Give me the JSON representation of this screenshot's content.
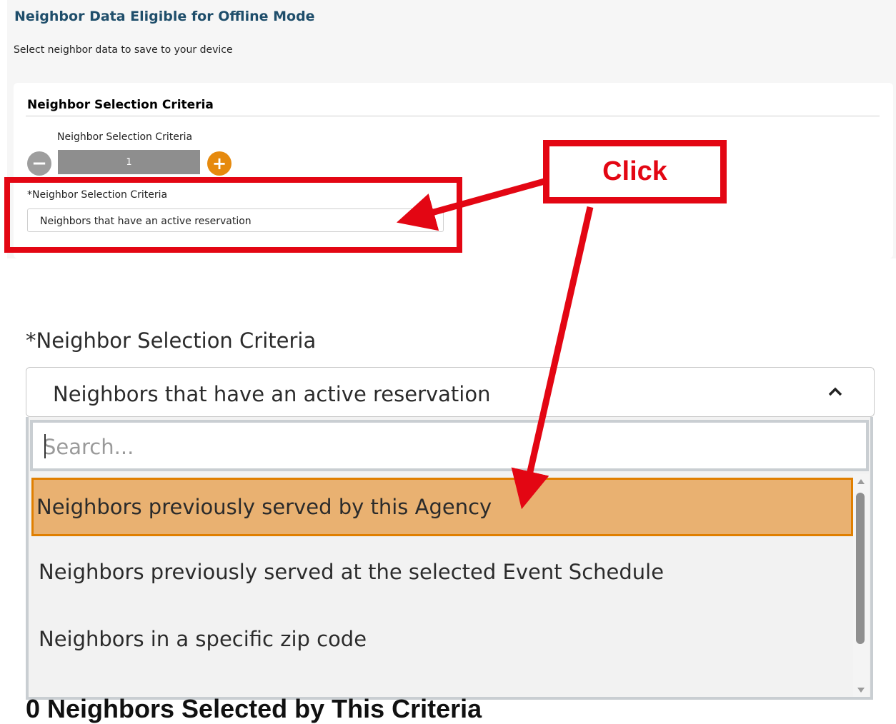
{
  "header": {
    "title": "Neighbor Data Eligible for Offline Mode",
    "subtitle": "Select neighbor data to save to your device"
  },
  "criteria_card": {
    "header": "Neighbor Selection Criteria",
    "stepper": {
      "label": "Neighbor Selection Criteria",
      "minus_symbol": "−",
      "value": "1",
      "plus_symbol": "+"
    },
    "select": {
      "label": "*Neighbor Selection Criteria",
      "value": "Neighbors that have an active reservation"
    }
  },
  "annotation": {
    "callout_text": "Click",
    "color": "#e30613"
  },
  "zoomed_dropdown": {
    "label": "*Neighbor Selection Criteria",
    "selected_value": "Neighbors that have an active reservation",
    "search_placeholder": "Search...",
    "options": [
      {
        "label": "Neighbors previously served by this Agency",
        "highlighted": true
      },
      {
        "label": "Neighbors previously served at the selected Event Schedule",
        "highlighted": false
      },
      {
        "label": "Neighbors in a specific zip code",
        "highlighted": false
      }
    ]
  },
  "result": {
    "count_text": "0 Neighbors Selected by This Criteria"
  },
  "colors": {
    "title_blue": "#1f4e6b",
    "accent_orange": "#e68a0e",
    "highlight_option": "#e9b171",
    "highlight_border": "#e07f00"
  }
}
